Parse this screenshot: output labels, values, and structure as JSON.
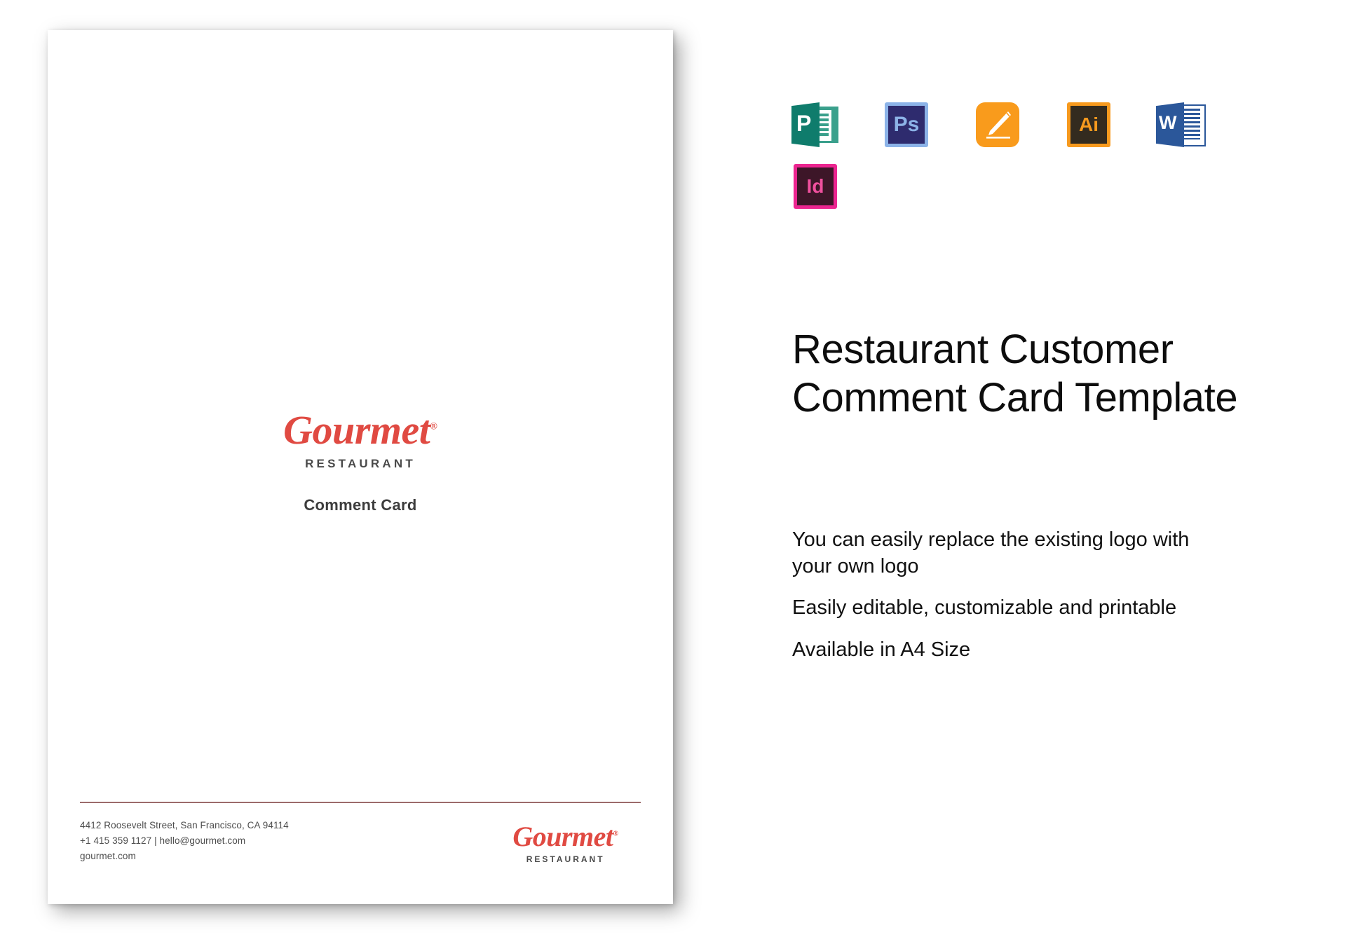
{
  "preview_card": {
    "brand": {
      "name": "Gourmet",
      "trademark": "®",
      "tagline": "RESTAURANT",
      "color": "#e04a42"
    },
    "subtitle": "Comment Card",
    "footer": {
      "divider_color": "#9c6b6b",
      "address_line1": "4412 Roosevelt Street, San Francisco, CA 94114",
      "address_line2": "+1 415 359 1127 | hello@gourmet.com",
      "address_line3": "gourmet.com",
      "brand_name": "Gourmet",
      "brand_trademark": "®",
      "brand_tagline": "RESTAURANT"
    }
  },
  "info": {
    "title": "Restaurant Customer Comment Card Template",
    "features": [
      "You can easily replace the existing logo with your own logo",
      "Easily editable, customizable and printable",
      "Available in A4 Size"
    ],
    "formats": [
      {
        "name": "publisher-icon",
        "label": "P",
        "color": "#0f7c6c"
      },
      {
        "name": "photoshop-icon",
        "label": "Ps",
        "color": "#2e2b6e"
      },
      {
        "name": "pages-icon",
        "label": "",
        "color": "#f99b1c"
      },
      {
        "name": "illustrator-icon",
        "label": "Ai",
        "color": "#f79a1e"
      },
      {
        "name": "word-icon",
        "label": "W",
        "color": "#2b579a"
      },
      {
        "name": "indesign-icon",
        "label": "Id",
        "color": "#ec2590"
      }
    ]
  }
}
